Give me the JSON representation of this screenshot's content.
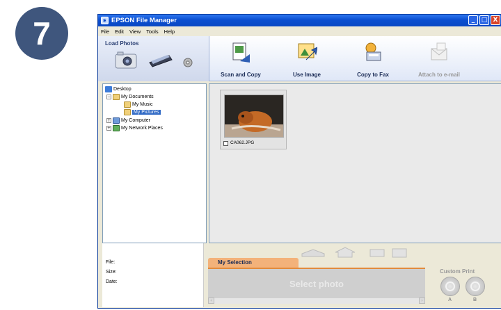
{
  "step_number": "7",
  "window": {
    "title": "EPSON File Manager",
    "controls": {
      "minimize": "_",
      "maximize": "□",
      "close": "X"
    }
  },
  "menu": [
    "File",
    "Edit",
    "View",
    "Tools",
    "Help"
  ],
  "load_photos": {
    "title": "Load Photos",
    "icons": [
      "camera-icon",
      "scanner-icon",
      "disc-icon"
    ]
  },
  "tools": [
    {
      "label": "Scan and Copy",
      "icon": "scan-copy-icon",
      "enabled": true
    },
    {
      "label": "Use Image",
      "icon": "use-image-icon",
      "enabled": true
    },
    {
      "label": "Copy to Fax",
      "icon": "fax-icon",
      "enabled": true
    },
    {
      "label": "Attach to e-mail",
      "icon": "email-icon",
      "enabled": false
    }
  ],
  "tree": {
    "root": "Desktop",
    "items": [
      {
        "label": "My Documents",
        "icon": "folder-icon",
        "expander": "−"
      },
      {
        "label": "My Music",
        "icon": "music-folder-icon"
      },
      {
        "label": "My Pictures",
        "icon": "pictures-folder-icon",
        "selected": true
      },
      {
        "label": "My Computer",
        "icon": "computer-icon",
        "expander": "+"
      },
      {
        "label": "My Network Places",
        "icon": "network-icon",
        "expander": "+"
      }
    ]
  },
  "photos": [
    {
      "filename": "CA062.JPG",
      "checked": false
    }
  ],
  "info": {
    "file_label": "File:",
    "size_label": "Size:",
    "date_label": "Date:"
  },
  "selection": {
    "tab_label": "My Selection",
    "placeholder": "Select photo"
  },
  "custom_print": {
    "title": "Custom Print",
    "a_label": "A",
    "b_label": "B"
  },
  "colors": {
    "badge": "#3f567d",
    "titlebar": "#0b4fd0",
    "selection_tab": "#f3b27a",
    "tree_selection": "#316ac5"
  }
}
